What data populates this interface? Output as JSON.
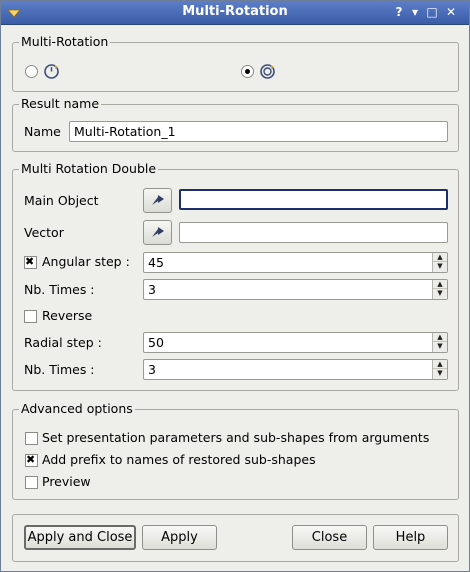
{
  "window": {
    "title": "Multi-Rotation",
    "help_glyph": "?",
    "minimize_glyph": "▾",
    "maximize_glyph": "□",
    "close_glyph": "✕"
  },
  "multi_rotation": {
    "title": "Multi-Rotation",
    "options": [
      {
        "checked": false,
        "icon": "rotation-simple-icon"
      },
      {
        "checked": true,
        "icon": "rotation-double-icon"
      }
    ]
  },
  "result": {
    "title": "Result name",
    "name_label": "Name",
    "name_value": "Multi-Rotation_1"
  },
  "double": {
    "title": "Multi Rotation Double",
    "main_object_label": "Main Object",
    "main_object_value": "",
    "vector_label": "Vector",
    "vector_value": "",
    "angular_checked": true,
    "angular_label": "Angular step :",
    "angular_value": "45",
    "nb_times_1_label": "Nb. Times :",
    "nb_times_1_value": "3",
    "reverse_checked": false,
    "reverse_label": "Reverse",
    "radial_label": "Radial step :",
    "radial_value": "50",
    "nb_times_2_label": "Nb. Times :",
    "nb_times_2_value": "3"
  },
  "advanced": {
    "title": "Advanced options",
    "opt1_label": "Set presentation parameters and sub-shapes from arguments",
    "opt1_checked": false,
    "opt2_label": "Add prefix to names of restored sub-shapes",
    "opt2_checked": true,
    "opt3_label": "Preview",
    "opt3_checked": false
  },
  "buttons": {
    "apply_close": "Apply and Close",
    "apply": "Apply",
    "close": "Close",
    "help": "Help"
  },
  "colors": {
    "titlebar": "#4a6cb8",
    "background": "#eeeeea",
    "focus_border": "#1f2e66"
  }
}
